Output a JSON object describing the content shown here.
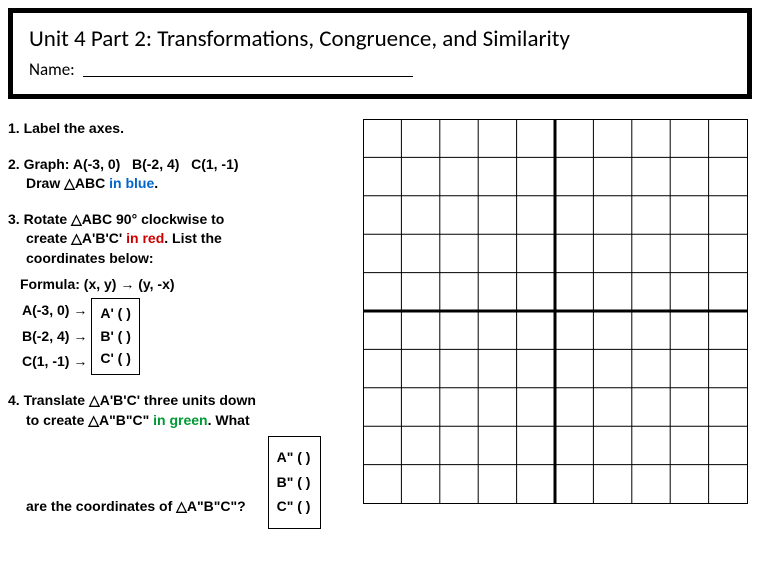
{
  "header": {
    "title": "Unit 4 Part 2: Transformations, Congruence, and Similarity",
    "name_label": "Name:"
  },
  "q1": {
    "num": "1.",
    "text": "Label the axes."
  },
  "q2": {
    "num": "2.",
    "graph_label": "Graph:",
    "A": "A(-3, 0)",
    "B": "B(-2, 4)",
    "C": "C(1, -1)",
    "draw": "Draw △ABC ",
    "color": "in blue",
    "end": "."
  },
  "q3": {
    "num": "3.",
    "line1a": "Rotate △ABC 90° clockwise to",
    "line2a": "create △A'B'C' ",
    "color": "in red",
    "line2b": ". List the",
    "line3": "coordinates below:",
    "formula": "Formula: (x, y) → (y, -x)",
    "rowA_left": "A(-3, 0) →",
    "rowA_right": "A' (           )",
    "rowB_left": "B(-2, 4) →",
    "rowB_right": "B' (           )",
    "rowC_left": "C(1, -1) →",
    "rowC_right": "C' (           )"
  },
  "q4": {
    "num": "4.",
    "line1": "Translate △A'B'C' three units down",
    "line2a": "to create △A\"B\"C\" ",
    "color": "in green",
    "line2b": ". What",
    "line3": "are the coordinates of △A\"B\"C\"?",
    "rowA": "A\" (           )",
    "rowB": "B\" (           )",
    "rowC": "C\" (           )"
  }
}
